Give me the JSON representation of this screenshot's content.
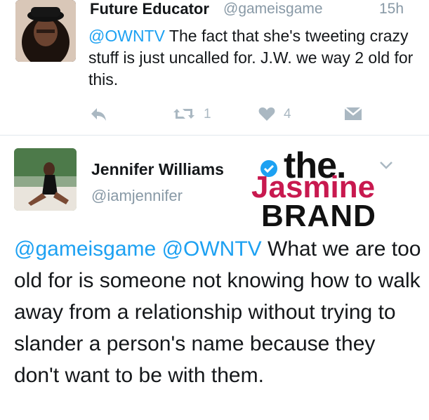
{
  "tweet1": {
    "name": "Future Educator",
    "handle": "@gameisgame",
    "time": "15h",
    "mention": "@OWNTV",
    "text": " The fact that she's tweeting crazy stuff is just uncalled for.  J.W. we way 2 old for this.",
    "retweet_count": "1",
    "like_count": "4",
    "icons": {
      "reply": "reply-icon",
      "retweet": "retweet-icon",
      "like": "heart-icon",
      "dm": "direct-message-icon"
    }
  },
  "tweet2": {
    "name": "Jennifer Williams",
    "handle": "@iamjennifer",
    "mention1": "@gameisgame",
    "mention2": "@OWNTV",
    "text": " What we are too old for is someone not knowing how to walk away from a relationship without trying to slander a person's name because they don't want to be with them."
  },
  "watermark": {
    "line1": "the.",
    "line2": "Jasmine",
    "line3": "BRAND"
  },
  "colors": {
    "link": "#1da1f2",
    "muted": "#8899a6",
    "icon": "#aab8c2",
    "watermark_accent": "#c8194f"
  }
}
